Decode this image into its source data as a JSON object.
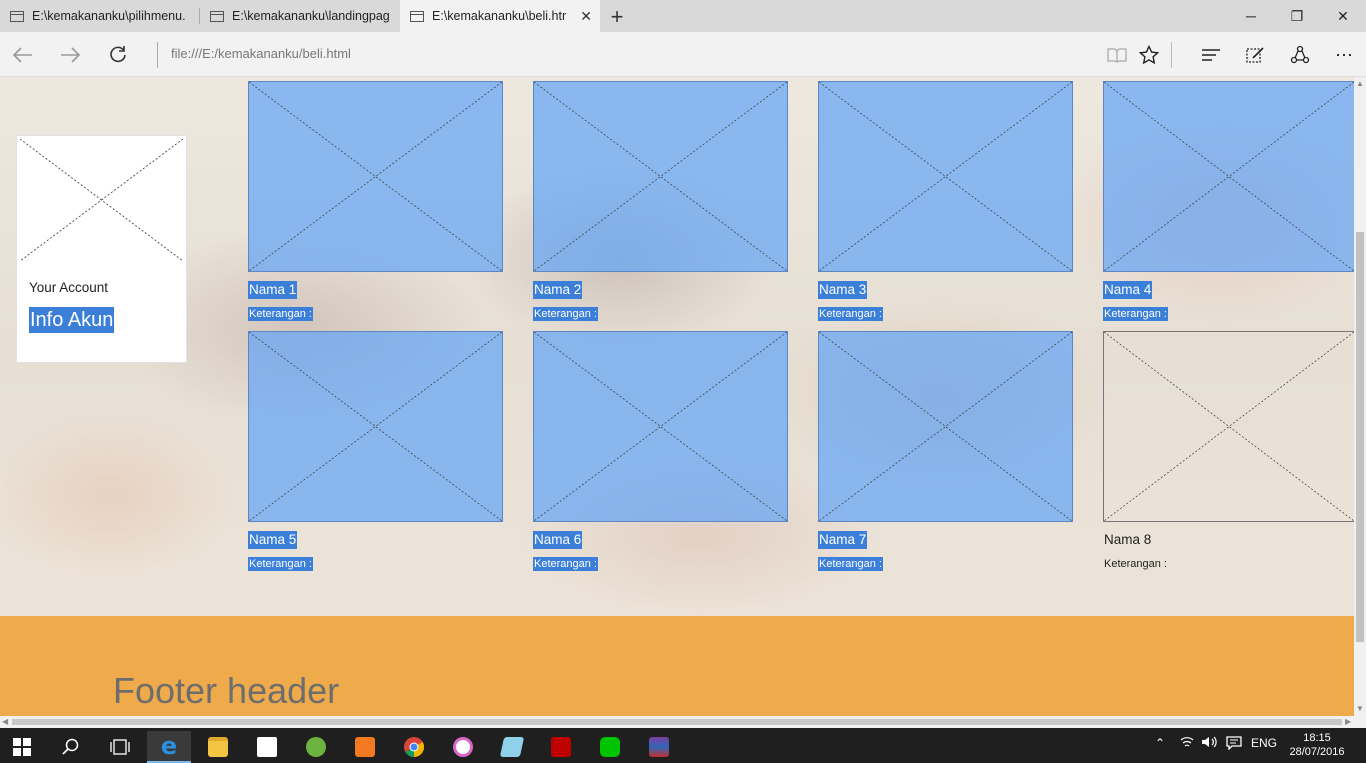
{
  "browser": {
    "tabs": [
      {
        "label": "E:\\kemakananku\\pilihmenu."
      },
      {
        "label": "E:\\kemakananku\\landingpag"
      },
      {
        "label": "E:\\kemakananku\\beli.htr"
      }
    ],
    "address": "file:///E:/kemakananku/beli.html"
  },
  "account": {
    "title": "Your Account",
    "link": "Info Akun"
  },
  "products": [
    {
      "name": "Nama 1",
      "desc": "Keterangan :"
    },
    {
      "name": "Nama 2",
      "desc": "Keterangan :"
    },
    {
      "name": "Nama 3",
      "desc": "Keterangan :"
    },
    {
      "name": "Nama 4",
      "desc": "Keterangan :"
    },
    {
      "name": "Nama 5",
      "desc": "Keterangan :"
    },
    {
      "name": "Nama 6",
      "desc": "Keterangan :"
    },
    {
      "name": "Nama 7",
      "desc": "Keterangan :"
    },
    {
      "name": "Nama 8",
      "desc": "Keterangan :"
    }
  ],
  "footer": {
    "header": "Footer header"
  },
  "taskbar": {
    "language": "ENG",
    "time": "18:15",
    "date": "28/07/2016"
  },
  "colors": {
    "selection": "#3b7fd8",
    "footer": "#efab4b"
  }
}
